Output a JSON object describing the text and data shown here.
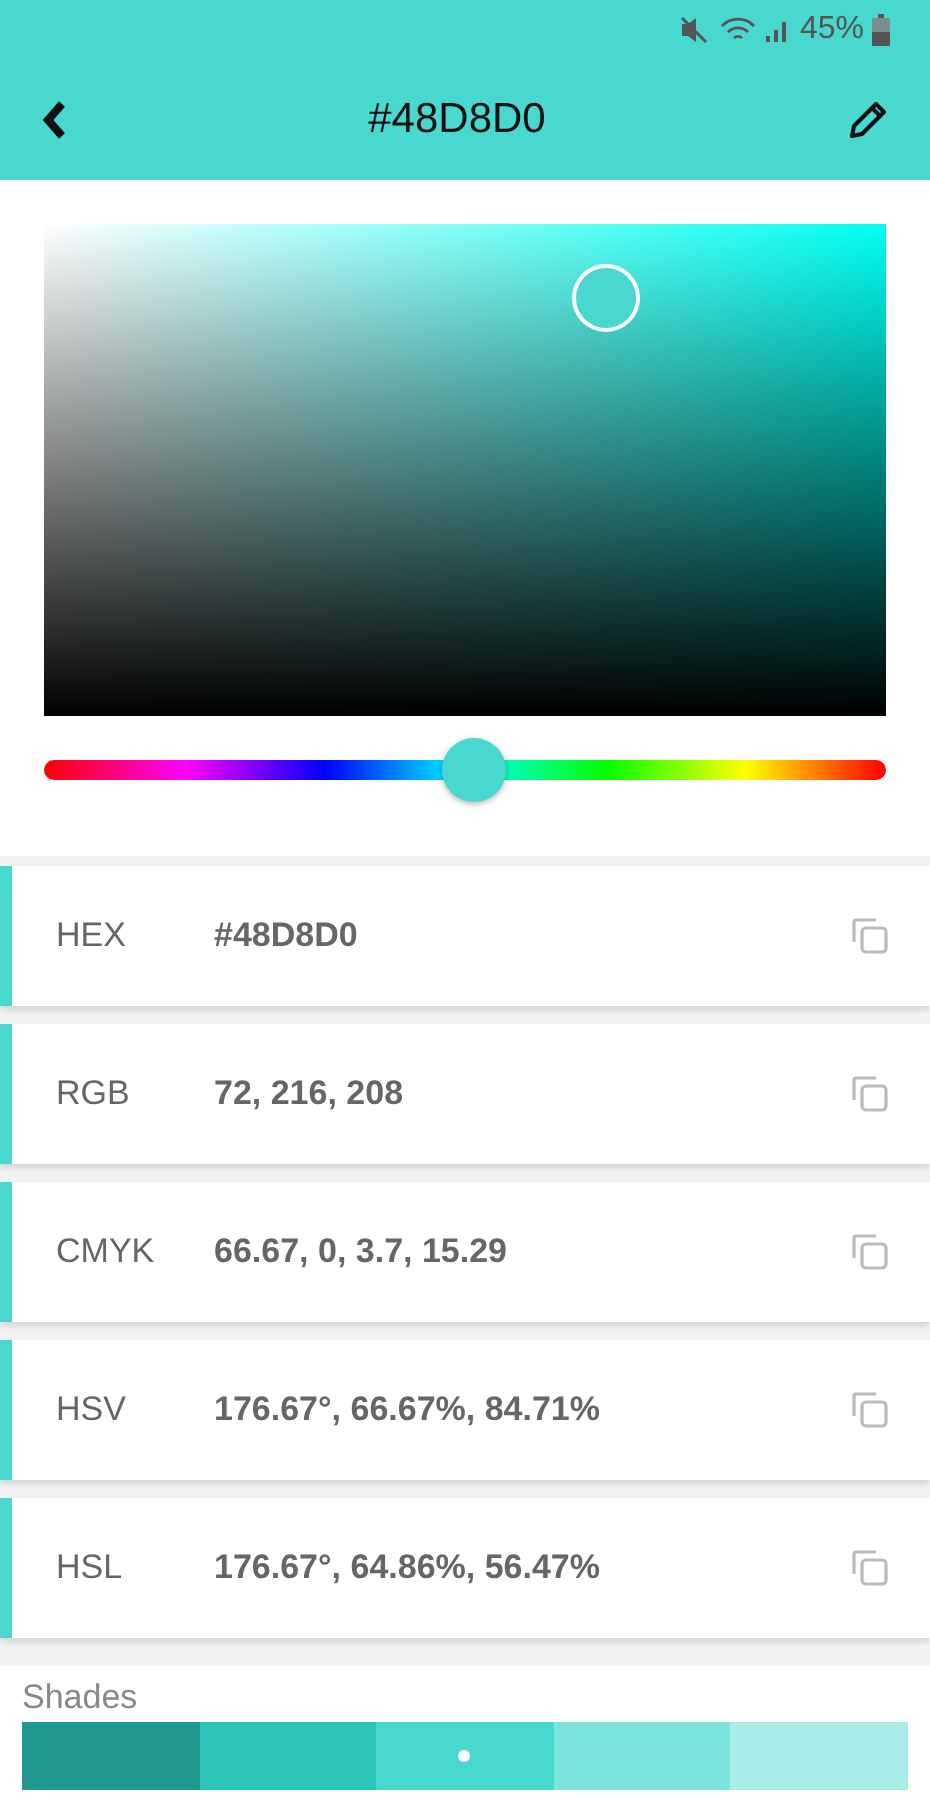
{
  "status_bar": {
    "battery": "45%"
  },
  "toolbar": {
    "title": "#48D8D0"
  },
  "picker": {
    "color": "#48d8d0",
    "hue": {
      "level": 0.51
    }
  },
  "values": [
    {
      "label": "HEX",
      "value": "#48D8D0"
    },
    {
      "label": "RGB",
      "value": "72, 216, 208"
    },
    {
      "label": "CMYK",
      "value": "66.67, 0, 3.7, 15.29"
    },
    {
      "label": "HSV",
      "value": "176.67°, 66.67%, 84.71%"
    },
    {
      "label": "HSL",
      "value": "176.67°, 64.86%, 56.47%"
    }
  ],
  "shades": {
    "title": "Shades",
    "items": [
      {
        "color": "#1f9990",
        "selected": false
      },
      {
        "color": "#2bc4b9",
        "selected": false
      },
      {
        "color": "#48d8d0",
        "selected": true
      },
      {
        "color": "#7be3dd",
        "selected": false
      },
      {
        "color": "#a9ede9",
        "selected": false
      }
    ]
  }
}
